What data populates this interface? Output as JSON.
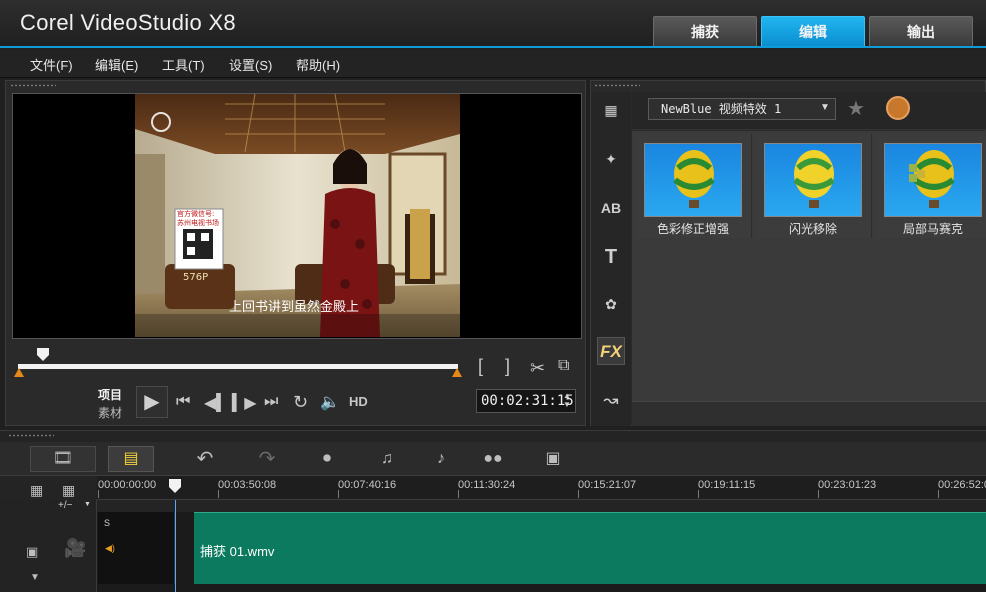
{
  "app": {
    "title": "Corel VideoStudio X8"
  },
  "mode_tabs": [
    {
      "label": "捕获",
      "active": false
    },
    {
      "label": "编辑",
      "active": true
    },
    {
      "label": "输出",
      "active": false
    }
  ],
  "menu": [
    {
      "label": "文件(F)"
    },
    {
      "label": "编辑(E)"
    },
    {
      "label": "工具(T)"
    },
    {
      "label": "设置(S)"
    },
    {
      "label": "帮助(H)"
    }
  ],
  "player": {
    "project_label": "项目",
    "clip_label": "素材",
    "hd_label": "HD",
    "timecode": "00:02:31:15",
    "mark_in": "[",
    "mark_out": "]",
    "video_subtitle": "上回书讲到虽然金殿上",
    "video_overlay_top": "官方微信号:",
    "video_overlay_mid": "苏州电视书场",
    "video_overlay_num": "576P"
  },
  "library": {
    "filter_value": "NewBlue 视频特效 1",
    "sidebar": [
      {
        "name": "media"
      },
      {
        "name": "instant-project"
      },
      {
        "name": "transition"
      },
      {
        "name": "title"
      },
      {
        "name": "graphic"
      },
      {
        "name": "filter",
        "label": "FX",
        "active": true
      },
      {
        "name": "path"
      }
    ],
    "items": [
      {
        "label": "色彩修正增强"
      },
      {
        "label": "闪光移除"
      },
      {
        "label": "局部马赛克"
      }
    ]
  },
  "timeline": {
    "ruler": [
      "00:00:00:00",
      "00:03:50:08",
      "00:07:40:16",
      "00:11:30:24",
      "00:15:21:07",
      "00:19:11:15",
      "00:23:01:23",
      "00:26:52:0"
    ],
    "track_add_label": "+/−",
    "clip_name": "捕获 01.wmv"
  },
  "colors": {
    "accent": "#0f9ad8",
    "clip": "#0b7a5e",
    "mark": "#e58a1a",
    "fx": "#f4d27a"
  }
}
